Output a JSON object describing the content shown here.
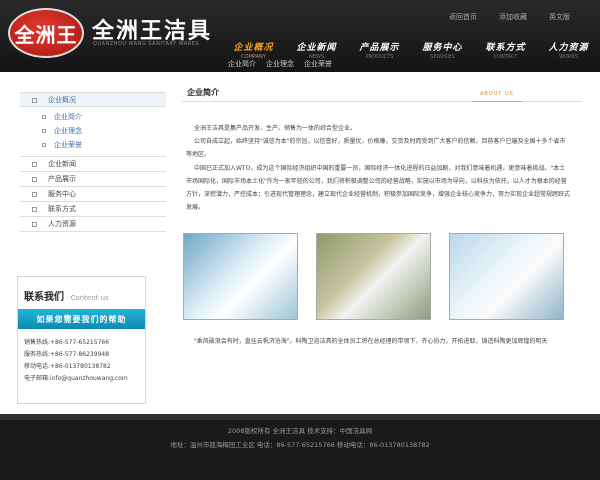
{
  "header": {
    "logo_text": "全洲王",
    "brand": "全洲王洁具",
    "brand_en": "QUANZHOU WANG SANITARY WARES",
    "top_links": [
      "返回首页",
      "添加收藏",
      "英文版"
    ],
    "nav": [
      {
        "cn": "企业概况",
        "en": "COMPANY",
        "active": true
      },
      {
        "cn": "企业新闻",
        "en": "NEWS",
        "active": false
      },
      {
        "cn": "产品展示",
        "en": "PRODUCTS",
        "active": false
      },
      {
        "cn": "服务中心",
        "en": "SERVICES",
        "active": false
      },
      {
        "cn": "联系方式",
        "en": "CONTACT",
        "active": false
      },
      {
        "cn": "人力资源",
        "en": "WORKS",
        "active": false
      }
    ],
    "subnav": [
      "企业简介",
      "企业理念",
      "企业荣誉"
    ]
  },
  "sidebar": {
    "items": [
      "企业概况",
      "企业新闻",
      "产品展示",
      "服务中心",
      "联系方式",
      "人力资源"
    ],
    "sub_items": [
      "企业简介",
      "企业理念",
      "企业荣誉"
    ]
  },
  "contact": {
    "title": "联系我们",
    "title_en": "Content us",
    "banner": "如果您需要我们的帮助",
    "lines": [
      {
        "label": "销售热线:",
        "value": "+86-577-65215766"
      },
      {
        "label": "服务热线:",
        "value": "+86-577-86239948"
      },
      {
        "label": "移动电话:",
        "value": "+86-013780138782"
      },
      {
        "label": "电子邮箱:",
        "value": "info@quanzhouwang.com"
      }
    ]
  },
  "main": {
    "title": "企业简介",
    "title_en": "ABOUT US",
    "paragraphs": [
      "全洲王洁具是集产品开发、生产、销售为一体的综合型企业。",
      "公司自成立起，始终坚持\"诚信为本\"的宗旨，以信誉好，质量优，价格廉，交货及时而受到广大客户的信赖。目前客户已遍及全国十多个省市等地区。",
      "中国已正式加入WTO，成为这个国际经济组织中国的重要一员，国际经济一体化进程的日益加剧，对我们意味着机遇，更意味着挑战。\"本土市场国际化，国际市场本土化\"作为一家年轻的公司，我们将积极调整公司的经营战略，实施以市场为导向，以科技为依托，以人才为根本的经营方针，深挖潜力，严控成本；引进现代管理理念，建立现代企业经营机制，积极参加国际竞争，增强企业核心竞争力，努力实现企业超常规跨跃式发展。",
      "\"乘风破浪会有时，直挂云帆济沧海\"。科陶卫浴洁具的全体员工将在总经理的带领下，齐心协力，开拓进取，铸造科陶更加辉煌的明天"
    ]
  },
  "footer": {
    "line1": "2008版权所有 全洲王洁具   技术支持：中国洁具网",
    "line2": "地址：温州市瓯海梅田工业区    电话：86-577-65215766    移动电话：86-013780138782"
  }
}
